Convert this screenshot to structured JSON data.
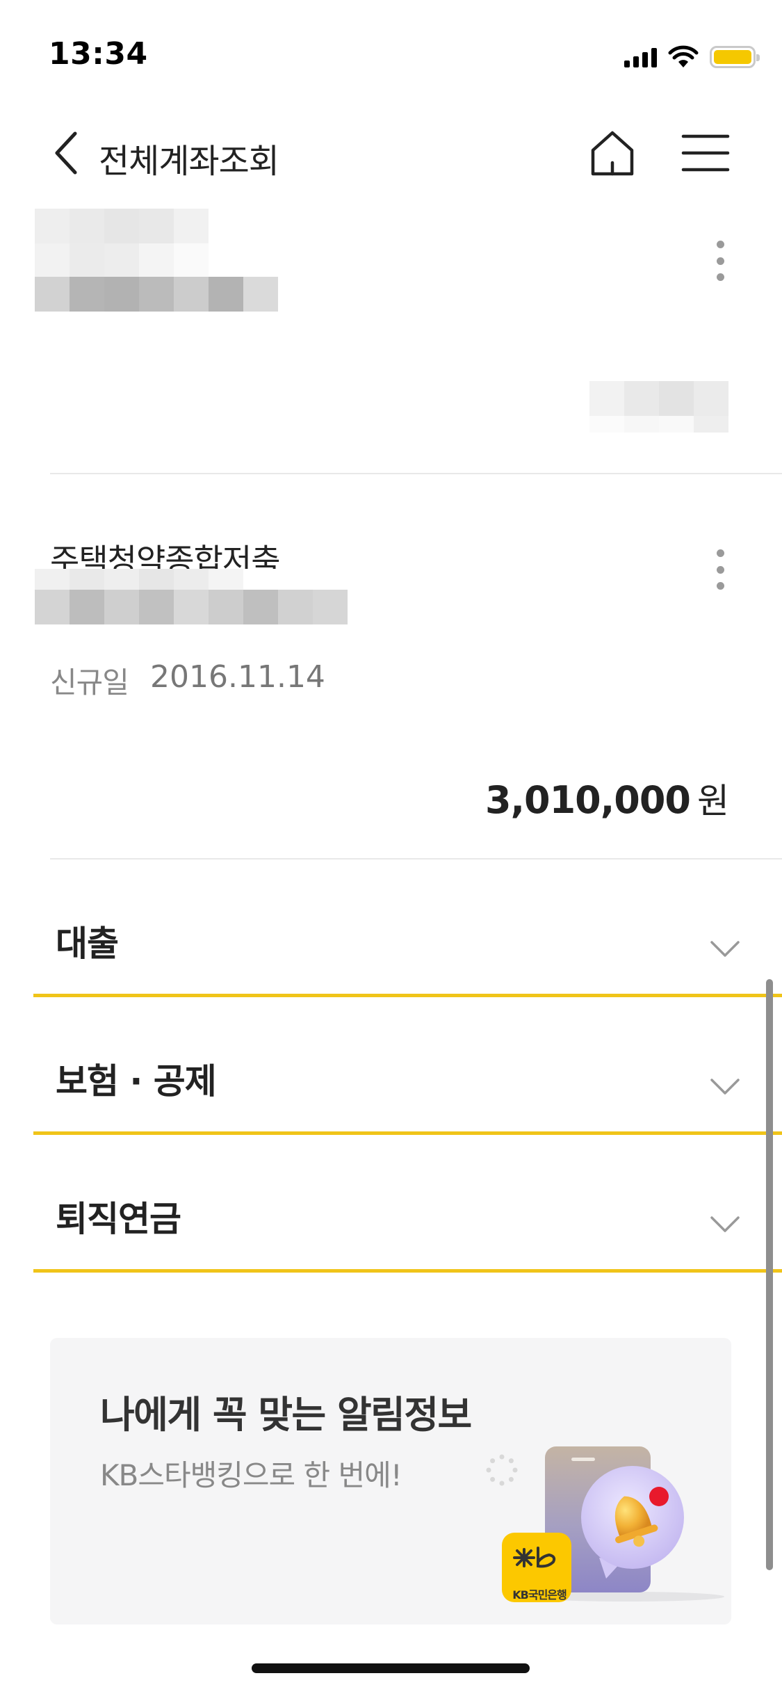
{
  "status_bar": {
    "time": "13:34"
  },
  "nav": {
    "title": "전체계좌조회"
  },
  "account_2": {
    "name": "주택청약종합저축",
    "open_label": "신규일",
    "open_date": "2016.11.14",
    "balance": "3,010,000",
    "unit": "원"
  },
  "sections": [
    {
      "label": "대출"
    },
    {
      "label": "보험 · 공제"
    },
    {
      "label": "퇴직연금"
    }
  ],
  "banner": {
    "title": "나에게 꼭 맞는 알림정보",
    "subtitle": "KB스타뱅킹으로 한 번에!",
    "logo_text": "KB국민은행"
  },
  "colors": {
    "accent": "#f0c419",
    "battery": "#f5c800",
    "badge": "#fcc800",
    "bell_dot": "#e8192c"
  },
  "icons": [
    "back-icon",
    "home-icon",
    "menu-icon",
    "more-icon",
    "chevron-down-icon",
    "wifi-icon",
    "signal-icon",
    "battery-icon",
    "bell-icon",
    "kb-logo-icon"
  ]
}
